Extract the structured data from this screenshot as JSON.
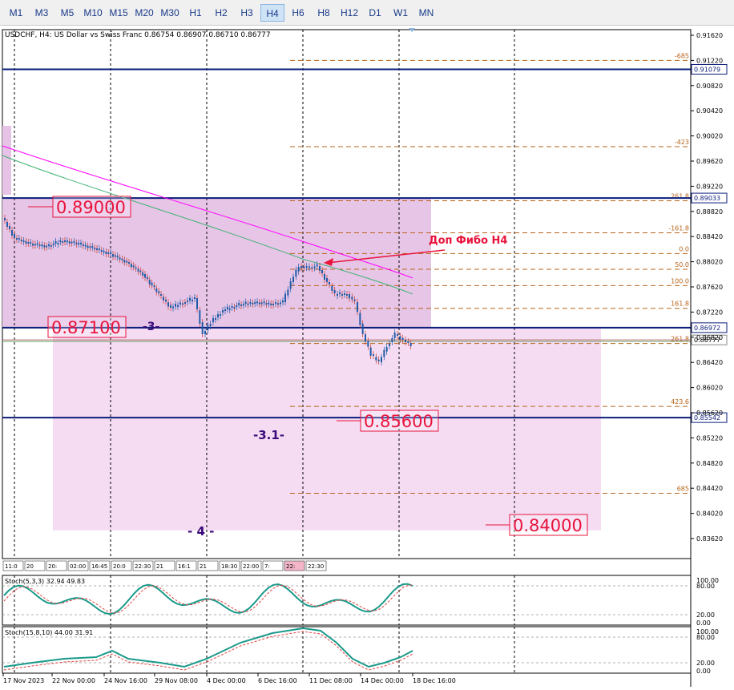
{
  "toolbar": {
    "timeframes": [
      "M1",
      "M3",
      "M5",
      "M10",
      "M15",
      "M20",
      "M30",
      "H1",
      "H2",
      "H3",
      "H4",
      "H6",
      "H8",
      "H12",
      "D1",
      "W1",
      "MN"
    ],
    "active": "H4"
  },
  "chart": {
    "header": "USDCHF, H4:  US Dollar vs Swiss Franc  0.86754 0.86907 0.86710 0.86777",
    "price_ticks": [
      {
        "v": 0.9162,
        "label": "0.91620"
      },
      {
        "v": 0.9122,
        "label": "0.91220"
      },
      {
        "v": 0.9082,
        "label": "0.90820"
      },
      {
        "v": 0.9042,
        "label": "0.90420"
      },
      {
        "v": 0.9002,
        "label": "0.90020"
      },
      {
        "v": 0.8962,
        "label": "0.89620"
      },
      {
        "v": 0.8922,
        "label": "0.89220"
      },
      {
        "v": 0.8882,
        "label": "0.88820"
      },
      {
        "v": 0.8842,
        "label": "0.88420"
      },
      {
        "v": 0.8802,
        "label": "0.88020"
      },
      {
        "v": 0.8762,
        "label": "0.87620"
      },
      {
        "v": 0.8722,
        "label": "0.87220"
      },
      {
        "v": 0.8682,
        "label": "0.86820"
      },
      {
        "v": 0.8642,
        "label": "0.86420"
      },
      {
        "v": 0.8602,
        "label": "0.86020"
      },
      {
        "v": 0.8562,
        "label": "0.85620"
      },
      {
        "v": 0.8522,
        "label": "0.85220"
      },
      {
        "v": 0.8482,
        "label": "0.84820"
      },
      {
        "v": 0.8442,
        "label": "0.84420"
      },
      {
        "v": 0.8402,
        "label": "0.84020"
      },
      {
        "v": 0.8362,
        "label": "0.83620"
      }
    ],
    "hlines": [
      {
        "v": 0.91079,
        "label": "0.91079"
      },
      {
        "v": 0.89033,
        "label": "0.89033"
      },
      {
        "v": 0.86972,
        "label": "0.86972"
      },
      {
        "v": 0.85542,
        "label": "0.85542"
      }
    ],
    "current_price": {
      "v": 0.86777,
      "label": "0.86777"
    },
    "fibo_levels": [
      {
        "v": 0.9122,
        "label": "-685"
      },
      {
        "v": 0.8985,
        "label": "-423"
      },
      {
        "v": 0.8899,
        "label": "261.8"
      },
      {
        "v": 0.8848,
        "label": "-161.8"
      },
      {
        "v": 0.8815,
        "label": "0.0"
      },
      {
        "v": 0.879,
        "label": "50.0"
      },
      {
        "v": 0.8764,
        "label": "100.0"
      },
      {
        "v": 0.8728,
        "label": "161.8"
      },
      {
        "v": 0.8672,
        "label": "261.8"
      },
      {
        "v": 0.8572,
        "label": "423.6"
      },
      {
        "v": 0.8434,
        "label": "685"
      }
    ],
    "price_labels": [
      {
        "text": "0.89000",
        "v": 0.8899
      },
      {
        "text": "0.87100",
        "v": 0.871
      },
      {
        "text": "0.85600",
        "v": 0.856
      },
      {
        "text": "0.84000",
        "v": 0.84
      }
    ],
    "wave_labels": [
      "-3-",
      "-3.1-",
      "- 4 -"
    ],
    "annotation": "Доп Фибо Н4",
    "session_labels": [
      "11:0",
      "20",
      "20:",
      "02:00",
      "16:45",
      "20:0",
      "22:30",
      "21",
      "16:1",
      "21",
      "18:30",
      "22:00",
      "7:",
      "22:",
      "22:30"
    ],
    "time_labels": [
      "17 Nov 2023",
      "22 Nov 00:00",
      "24 Nov 16:00",
      "29 Nov 08:00",
      "4 Dec 00:00",
      "6 Dec 16:00",
      "11 Dec 08:00",
      "14 Dec 00:00",
      "18 Dec 16:00"
    ],
    "stoch1": {
      "label": "Stoch(5,3,3) 32.94 49.83",
      "levels": [
        "100.00",
        "80.00",
        "20.00",
        "0.00"
      ]
    },
    "stoch2": {
      "label": "Stoch(15,8,10) 44.00 31.91",
      "levels": [
        "100.00",
        "80.00",
        "20.00",
        "0.00"
      ]
    },
    "colors": {
      "accent": "#1a3a8a",
      "zone_upper": "#e6c2e6",
      "zone_lower": "#f5dcf3",
      "hline": "#0a1d7a",
      "fibo": "#b8641a",
      "label_red": "#e8143c",
      "wave": "#3a0a7a",
      "ma_fast": "#ff00ff",
      "ma_slow": "#3cb371",
      "candle": "#1f5ca8",
      "candle_down": "#c0392b"
    }
  }
}
